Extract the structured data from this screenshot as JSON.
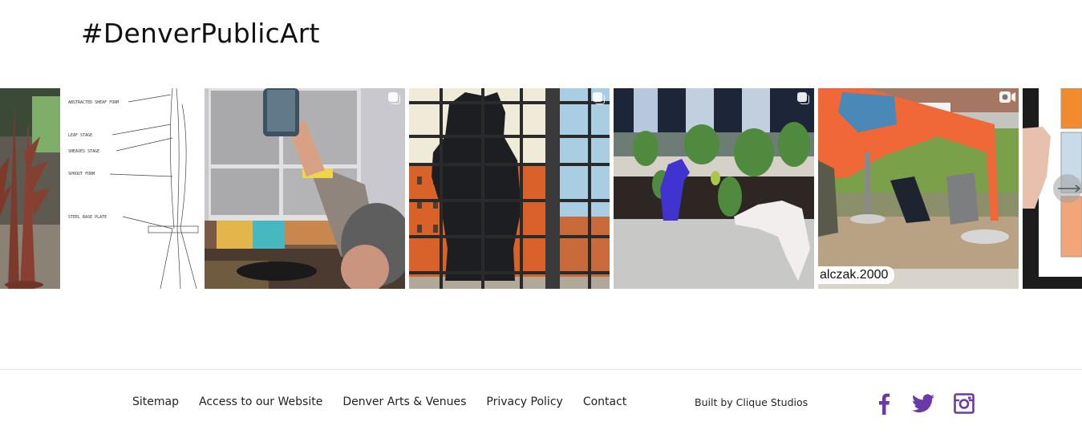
{
  "header": {
    "title": "#DenverPublicArt"
  },
  "feed": {
    "items": [
      {
        "description": "Rust-colored steel leaf sculptures in workshop",
        "type": "image"
      },
      {
        "description": "Pencil sketch of sculpture with labels",
        "type": "carousel",
        "annotations": [
          "ABSTRACTED SHEAF FORM",
          "LEAF STAGE",
          "SHEAVES STAGE",
          "SPROUT FORM",
          "STEEL BASE PLATE"
        ]
      },
      {
        "description": "Person raising phone at event",
        "type": "carousel"
      },
      {
        "description": "Silhouette of big blue bear through window",
        "type": "carousel"
      },
      {
        "description": "Blue bear figurine in pepper garden",
        "type": "carousel"
      },
      {
        "description": "Orange sculpture being installed",
        "type": "video",
        "handle": "alczak.2000"
      },
      {
        "description": "Hand holding illustrated page",
        "type": "image"
      }
    ],
    "next_label": "Next"
  },
  "footer": {
    "links": [
      "Sitemap",
      "Access to our Website",
      "Denver Arts & Venues",
      "Privacy Policy",
      "Contact"
    ],
    "built_by": "Built by Clique Studios",
    "social": [
      "facebook-icon",
      "twitter-icon",
      "instagram-icon"
    ],
    "accent_color": "#6a3aa8"
  }
}
